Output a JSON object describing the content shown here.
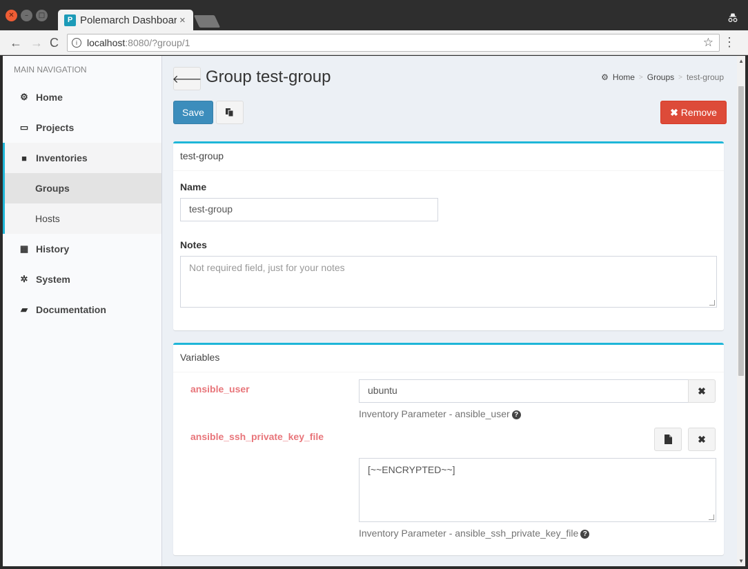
{
  "browser": {
    "tab_title": "Polemarch Dashboard",
    "tab_close": "×",
    "url_host": "localhost",
    "url_rest": ":8080/?group/1",
    "info_icon": "i"
  },
  "sidebar": {
    "header": "MAIN NAVIGATION",
    "items": [
      {
        "label": "Home",
        "icon": "dashboard-icon",
        "glyph": "⚙"
      },
      {
        "label": "Projects",
        "icon": "projects-icon",
        "glyph": "▭"
      },
      {
        "label": "Inventories",
        "icon": "folder-icon",
        "glyph": "■"
      },
      {
        "label": "History",
        "icon": "calendar-icon",
        "glyph": "▦"
      },
      {
        "label": "System",
        "icon": "gear-icon",
        "glyph": "✲"
      },
      {
        "label": "Documentation",
        "icon": "book-icon",
        "glyph": "▰"
      }
    ],
    "sub_items": [
      {
        "label": "Groups"
      },
      {
        "label": "Hosts"
      }
    ]
  },
  "header": {
    "title": "Group test-group",
    "breadcrumb": [
      "Home",
      "Groups",
      "test-group"
    ]
  },
  "toolbar": {
    "save_label": "Save",
    "remove_label": "Remove"
  },
  "group_box": {
    "header": "test-group",
    "name_label": "Name",
    "name_value": "test-group",
    "notes_label": "Notes",
    "notes_placeholder": "Not required field, just for your notes"
  },
  "variables_box": {
    "header": "Variables",
    "vars": [
      {
        "key": "ansible_user",
        "value": "ubuntu",
        "help": "Inventory Parameter - ansible_user"
      },
      {
        "key": "ansible_ssh_private_key_file",
        "value": "[~~ENCRYPTED~~]",
        "help": "Inventory Parameter - ansible_ssh_private_key_file"
      }
    ]
  },
  "colors": {
    "accent": "#1eb6d8",
    "primary": "#3c8dbc",
    "danger": "#dd4b39",
    "var_key": "#e8757a"
  }
}
